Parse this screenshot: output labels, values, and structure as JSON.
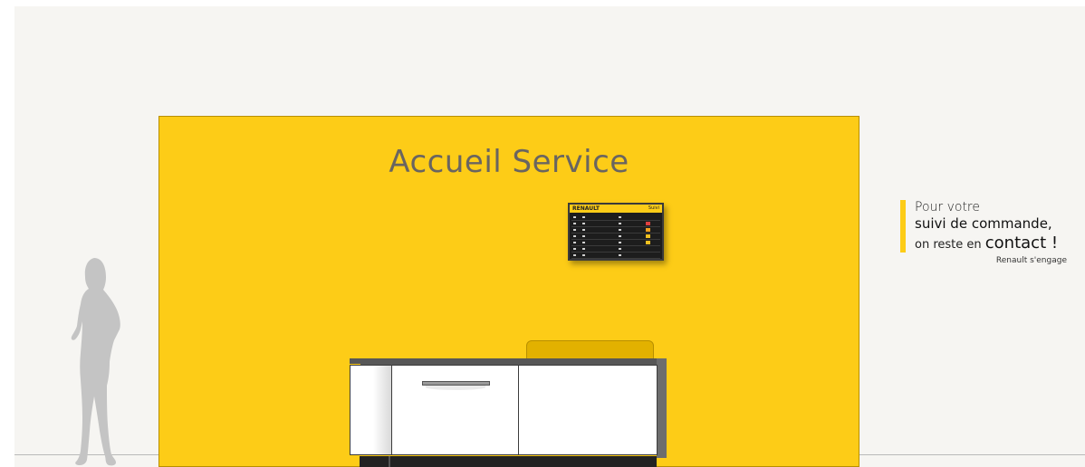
{
  "wall": {
    "title": "Accueil Service",
    "color": "#fdcc17"
  },
  "screen": {
    "header_text": "RENAULT",
    "header_right": "Suivi"
  },
  "promo": {
    "line1": "Pour votre",
    "line2": "suivi de commande,",
    "line3_prefix": "on reste en ",
    "line3_emphasis": "contact !",
    "signature": "Renault s'engage",
    "accent_color": "#fdcc17"
  },
  "icons": {
    "person": "person-silhouette-icon"
  }
}
